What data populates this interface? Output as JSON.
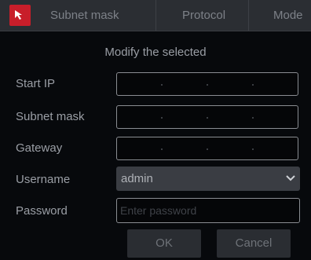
{
  "table_header": {
    "columns": [
      "Subnet mask",
      "Protocol",
      "Mode"
    ]
  },
  "dialog": {
    "title": "Modify the selected",
    "fields": {
      "start_ip": {
        "label": "Start IP"
      },
      "subnet_mask": {
        "label": "Subnet mask"
      },
      "gateway": {
        "label": "Gateway"
      },
      "username": {
        "label": "Username",
        "value": "admin"
      },
      "password": {
        "label": "Password",
        "placeholder": "Enter password"
      }
    },
    "buttons": {
      "ok": "OK",
      "cancel": "Cancel"
    }
  },
  "colors": {
    "accent": "#c81e2a",
    "dialog_bg": "#07090c",
    "header_bg": "#2b2e33"
  }
}
